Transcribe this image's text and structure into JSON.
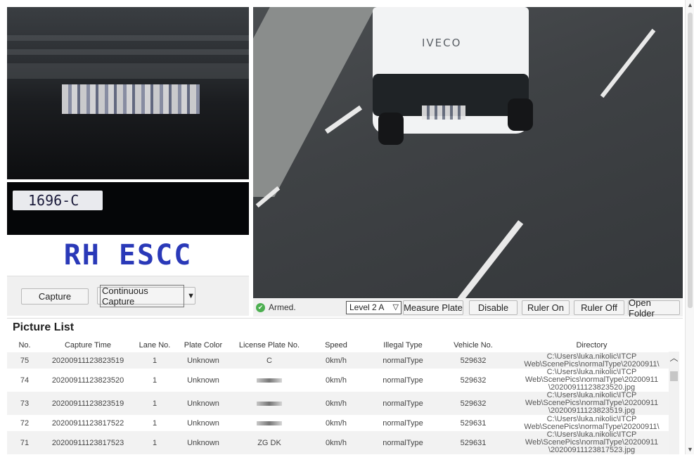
{
  "left_panel": {
    "plate_crop_text": "1696-C",
    "recognized_plate": "RH ESCC",
    "capture_label": "Capture",
    "continuous_capture_label": "Continuous Capture"
  },
  "scene": {
    "vehicle_logo": "IVECO"
  },
  "status_bar": {
    "armed_label": "Armed.",
    "level_select_value": "Level 2 A",
    "measure_plate_label": "Measure Plate",
    "disable_label": "Disable",
    "ruler_on_label": "Ruler On",
    "ruler_off_label": "Ruler Off",
    "open_folder_label": "Open Folder"
  },
  "picture_list": {
    "title": "Picture List",
    "columns": [
      "No.",
      "Capture Time",
      "Lane No.",
      "Plate Color",
      "License Plate No.",
      "Speed",
      "Illegal Type",
      "Vehicle No.",
      "Directory"
    ],
    "rows": [
      {
        "no": "75",
        "time": "20200911123823519",
        "lane": "1",
        "color": "Unknown",
        "plate": "C",
        "speed": "0km/h",
        "type": "normalType",
        "vehicle": "529632",
        "dir1": "C:\\Users\\luka.nikolic\\ITCP",
        "dir2": "Web\\ScenePics\\normalType\\20200911\\",
        "dir3": ""
      },
      {
        "no": "74",
        "time": "20200911123823520",
        "lane": "1",
        "color": "Unknown",
        "plate": "",
        "speed": "0km/h",
        "type": "normalType",
        "vehicle": "529632",
        "dir1": "C:\\Users\\luka.nikolic\\ITCP",
        "dir2": "Web\\ScenePics\\normalType\\20200911",
        "dir3": "\\20200911123823520.jpg"
      },
      {
        "no": "73",
        "time": "20200911123823519",
        "lane": "1",
        "color": "Unknown",
        "plate": "",
        "speed": "0km/h",
        "type": "normalType",
        "vehicle": "529632",
        "dir1": "C:\\Users\\luka.nikolic\\ITCP",
        "dir2": "Web\\ScenePics\\normalType\\20200911",
        "dir3": "\\20200911123823519.jpg"
      },
      {
        "no": "72",
        "time": "20200911123817522",
        "lane": "1",
        "color": "Unknown",
        "plate": "",
        "speed": "0km/h",
        "type": "normalType",
        "vehicle": "529631",
        "dir1": "C:\\Users\\luka.nikolic\\ITCP",
        "dir2": "Web\\ScenePics\\normalType\\20200911\\",
        "dir3": ""
      },
      {
        "no": "71",
        "time": "20200911123817523",
        "lane": "1",
        "color": "Unknown",
        "plate": "ZG    DK",
        "speed": "0km/h",
        "type": "normalType",
        "vehicle": "529631",
        "dir1": "C:\\Users\\luka.nikolic\\ITCP",
        "dir2": "Web\\ScenePics\\normalType\\20200911",
        "dir3": "\\20200911123817523.jpg"
      }
    ]
  },
  "icons": {
    "armed": "check-circle-icon",
    "dropdown": "chevron-down-icon",
    "scroll_up": "chevron-up-icon"
  },
  "colors": {
    "recognized_text": "#2a39b8",
    "armed_status": "#4caf50"
  }
}
